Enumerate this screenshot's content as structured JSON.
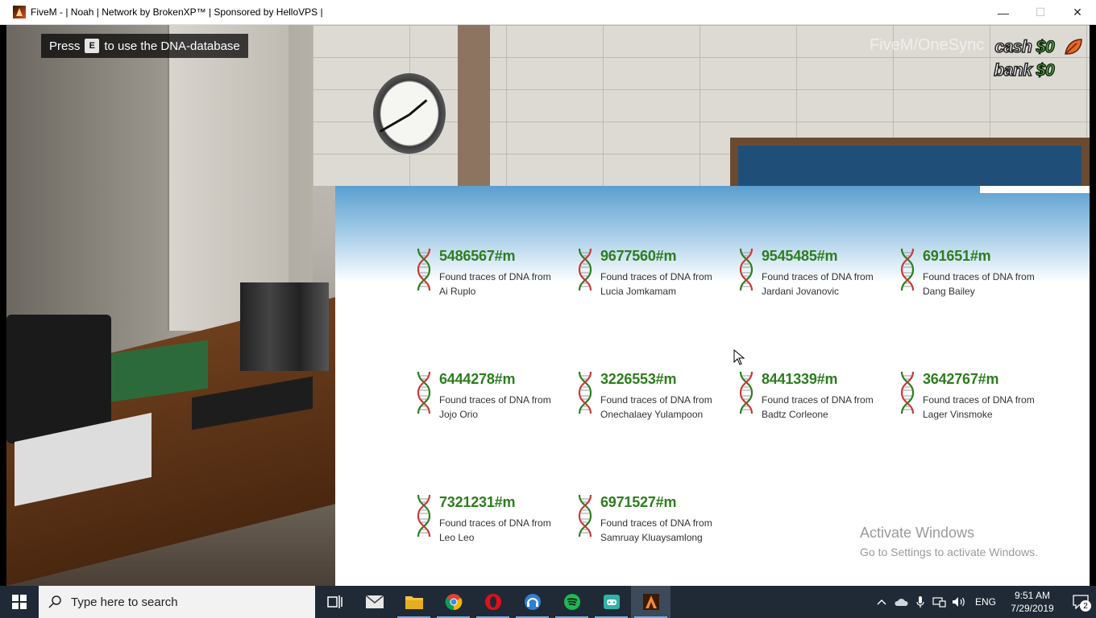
{
  "window": {
    "title": "FiveM - | Noah |  Network by BrokenXP™ |  Sponsored by HelloVPS |",
    "minimize": "—",
    "maximize": "☐",
    "close": "✕"
  },
  "hud": {
    "hint_prefix": "Press",
    "hint_key": "E",
    "hint_suffix": "to use the DNA-database",
    "server_tag": "FiveM/OneSync",
    "cash_label": "cash",
    "cash_value": "$0",
    "bank_label": "bank",
    "bank_value": "$0"
  },
  "dna_panel": {
    "entries": [
      {
        "id": "5486567#m",
        "desc_line1": "Found traces of DNA from",
        "desc_line2": "Ai Ruplo"
      },
      {
        "id": "9677560#m",
        "desc_line1": "Found traces of DNA from",
        "desc_line2": "Lucia Jomkamam"
      },
      {
        "id": "9545485#m",
        "desc_line1": "Found traces of DNA from",
        "desc_line2": "Jardani Jovanovic"
      },
      {
        "id": "691651#m",
        "desc_line1": "Found traces of DNA from",
        "desc_line2": "Dang Bailey"
      },
      {
        "id": "6444278#m",
        "desc_line1": "Found traces of DNA from",
        "desc_line2": "Jojo Orio"
      },
      {
        "id": "3226553#m",
        "desc_line1": "Found traces of DNA from",
        "desc_line2": "Onechalaey Yulampoon"
      },
      {
        "id": "8441339#m",
        "desc_line1": "Found traces of DNA from",
        "desc_line2": "Badtz Corleone"
      },
      {
        "id": "3642767#m",
        "desc_line1": "Found traces of DNA from",
        "desc_line2": "Lager Vinsmoke"
      },
      {
        "id": "7321231#m",
        "desc_line1": "Found traces of DNA from",
        "desc_line2": "Leo Leo"
      },
      {
        "id": "6971527#m",
        "desc_line1": "Found traces of DNA from",
        "desc_line2": "Samruay Kluaysamlong"
      }
    ],
    "accent_color": "#2d7d1e"
  },
  "watermark": {
    "heading": "Activate Windows",
    "sub": "Go to Settings to activate Windows."
  },
  "taskbar": {
    "search_placeholder": "Type here to search",
    "apps": [
      "task-view-icon",
      "mail-icon",
      "file-explorer-icon",
      "chrome-icon",
      "opera-icon",
      "teamspeak-icon",
      "spotify-icon",
      "gamepad-app-icon",
      "fivem-icon"
    ],
    "language": "ENG",
    "time": "9:51 AM",
    "date": "7/29/2019",
    "notification_count": "2"
  }
}
